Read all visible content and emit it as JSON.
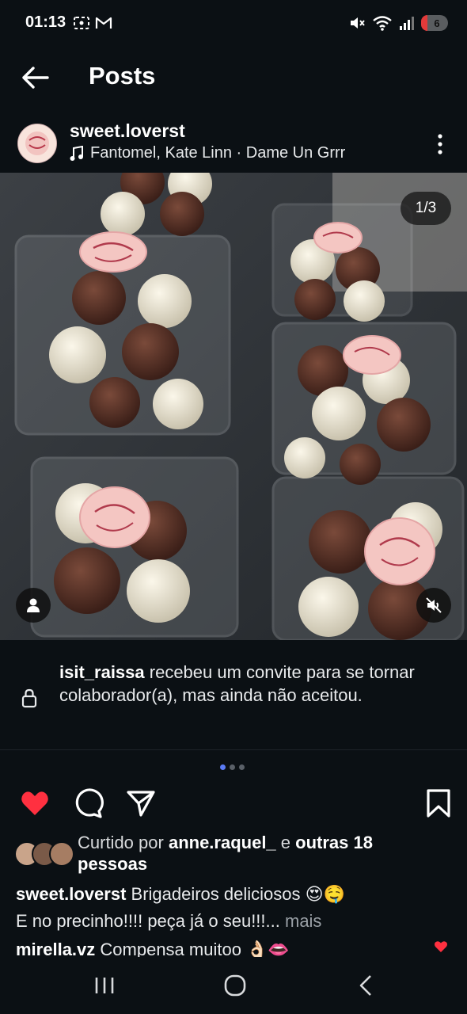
{
  "status_bar": {
    "time": "01:13",
    "battery": "6"
  },
  "header": {
    "title": "Posts"
  },
  "post": {
    "username": "sweet.loverst",
    "audio": "Fantomel, Kate Linn · Dame Un Grrr",
    "media_counter": "1/3",
    "collab_notice": {
      "user": "isit_raissa",
      "text": " recebeu um convite para se tornar colaborador(a), mas ainda não aceitou."
    },
    "likes": {
      "prefix": "Curtido por ",
      "user": "anne.raquel_",
      "middle": " e ",
      "others": "outras 18 pessoas"
    },
    "caption": {
      "user": "sweet.loverst",
      "line1": " Brigadeiros deliciosos 😍🤤",
      "line2": "E no precinho!!!! peça já o seu!!!...",
      "more": " mais"
    },
    "comment": {
      "user": "mirella.vz",
      "text": " Compensa muitoo 👌🏻👄"
    }
  },
  "icons": {
    "like": "heart-icon",
    "comment": "comment-icon",
    "share": "send-icon",
    "save": "bookmark-icon"
  },
  "colors": {
    "background": "#0b1014",
    "like_red": "#ff3040",
    "dot_active": "#5b7cf6"
  }
}
